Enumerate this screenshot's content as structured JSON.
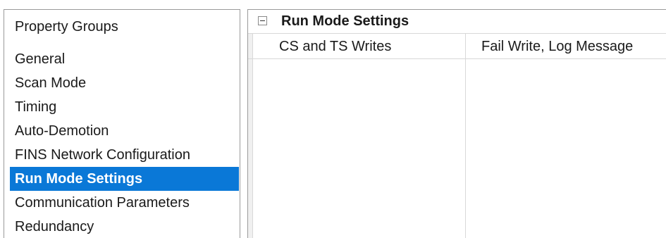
{
  "property_groups": {
    "header": "Property Groups",
    "items": [
      {
        "label": "General",
        "selected": false
      },
      {
        "label": "Scan Mode",
        "selected": false
      },
      {
        "label": "Timing",
        "selected": false
      },
      {
        "label": "Auto-Demotion",
        "selected": false
      },
      {
        "label": "FINS Network Configuration",
        "selected": false
      },
      {
        "label": "Run Mode Settings",
        "selected": true
      },
      {
        "label": "Communication Parameters",
        "selected": false
      },
      {
        "label": "Redundancy",
        "selected": false
      }
    ]
  },
  "property_grid": {
    "category": {
      "title": "Run Mode Settings",
      "expanded": true
    },
    "properties": [
      {
        "name": "CS and TS Writes",
        "value": "Fail Write, Log Message"
      }
    ]
  },
  "colors": {
    "selection": "#0a78d7",
    "selection_text": "#ffffff",
    "border": "#9a9a9a",
    "grid_line": "#d8d8d8"
  }
}
